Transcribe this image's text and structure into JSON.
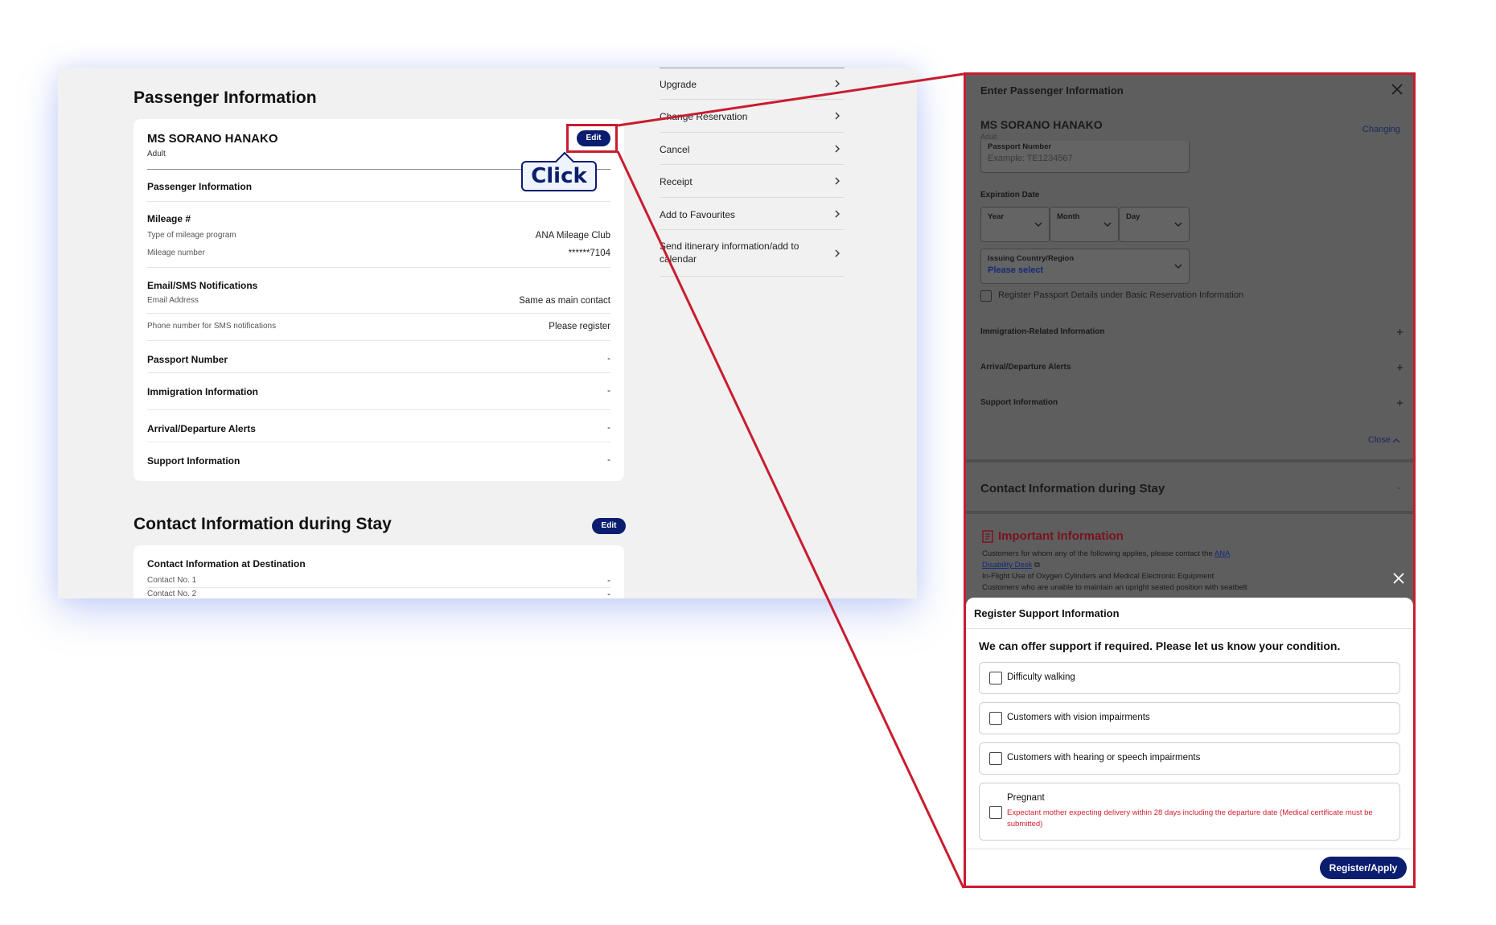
{
  "left": {
    "passenger_section_title": "Passenger Information",
    "passenger": {
      "name": "MS SORANO HANAKO",
      "type": "Adult",
      "edit_label": "Edit",
      "info_heading": "Passenger Information",
      "mileage_heading": "Mileage #",
      "mileage_program_label": "Type of mileage program",
      "mileage_program_value": "ANA Mileage Club",
      "mileage_number_label": "Mileage number",
      "mileage_number_value": "******7104",
      "notifications_heading": "Email/SMS Notifications",
      "email_label": "Email Address",
      "email_value": "Same as main contact",
      "phone_label": "Phone number for SMS notifications",
      "phone_value": "Please register",
      "passport_label": "Passport Number",
      "passport_value": "-",
      "immigration_label": "Immigration Information",
      "immigration_value": "-",
      "alerts_label": "Arrival/Departure Alerts",
      "alerts_value": "-",
      "support_label": "Support Information",
      "support_value": "-"
    },
    "click_callout": "Click",
    "contact_section_title": "Contact Information during Stay",
    "contact_edit_label": "Edit",
    "contact": {
      "heading": "Contact Information at Destination",
      "contact1_label": "Contact No. 1",
      "contact1_value": "-",
      "contact2_label": "Contact No. 2",
      "contact2_value": "-"
    },
    "menu": [
      {
        "label": "Upgrade"
      },
      {
        "label": "Change Reservation"
      },
      {
        "label": "Cancel"
      },
      {
        "label": "Receipt"
      },
      {
        "label": "Add to Favourites"
      },
      {
        "label": "Send itinerary information/add to calendar"
      }
    ]
  },
  "panel": {
    "header": "Enter Passenger Information",
    "name": "MS SORANO HANAKO",
    "type": "Adult",
    "changing": "Changing",
    "passport_label": "Passport Number",
    "passport_placeholder": "Example: TE1234567",
    "expiration_label": "Expiration Date",
    "year_label": "Year",
    "month_label": "Month",
    "day_label": "Day",
    "issuing_label": "Issuing Country/Region",
    "issuing_value": "Please select",
    "register_passport": "Register Passport Details under Basic Reservation Information",
    "accordion": [
      "Immigration-Related Information",
      "Arrival/Departure Alerts",
      "Support Information"
    ],
    "close_label": "Close",
    "contact_title": "Contact Information during Stay",
    "contact_dash": "-",
    "important_title": "Important Information",
    "important_line1_pre": "Customers for whom any of the following applies, please contact the ",
    "important_line1_link": "ANA",
    "important_line2_link": "Disability Desk",
    "important_line3": "In-Flight Use of Oxygen Cylinders and Medical Electronic Equipment",
    "important_line4": "Customers who are unable to maintain an upright seated position with seatbelt"
  },
  "sheet": {
    "title": "Register Support Information",
    "intro": "We can offer support if required. Please let us know your condition.",
    "options": [
      {
        "label": "Difficulty walking"
      },
      {
        "label": "Customers with vision impairments"
      },
      {
        "label": "Customers with hearing or speech impairments"
      },
      {
        "label": "Pregnant",
        "note": "Expectant mother expecting delivery within 28 days including the departure date (Medical certificate must be submitted)"
      }
    ],
    "register_label": "Register/Apply"
  },
  "colors": {
    "navy": "#0a1d6e",
    "highlight_red": "#c91c2f",
    "overlay_gray": "#5e5e5e"
  }
}
